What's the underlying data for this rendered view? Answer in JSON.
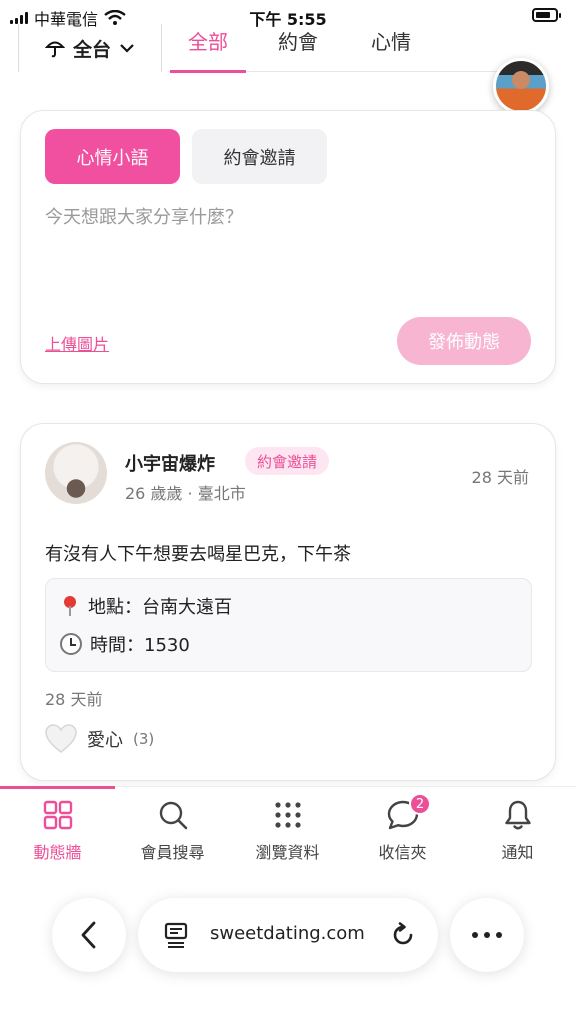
{
  "status_bar": {
    "carrier": "中華電信",
    "time": "下午 5:55"
  },
  "top_nav": {
    "region_label": "全台",
    "tabs": [
      {
        "label": "全部",
        "active": true
      },
      {
        "label": "約會",
        "active": false
      },
      {
        "label": "心情",
        "active": false
      }
    ]
  },
  "compose": {
    "tab_mood": "心情小語",
    "tab_date": "約會邀請",
    "placeholder": "今天想跟大家分享什麼？",
    "upload_label": "上傳圖片",
    "publish_label": "發佈動態"
  },
  "post": {
    "author": "小宇宙爆炸",
    "badge": "約會邀請",
    "meta": "26 歲歲 · 臺北市",
    "time": "28 天前",
    "content": "有沒有人下午想要去喝星巴克，下午茶",
    "location": "地點：台南大遠百",
    "datetime": "時間：1530",
    "footer_time": "28 天前",
    "like_label": "愛心",
    "like_count": "(3)"
  },
  "tabbar": {
    "items": [
      {
        "label": "動態牆",
        "icon": "grid-icon",
        "active": true
      },
      {
        "label": "會員搜尋",
        "icon": "search-icon",
        "active": false
      },
      {
        "label": "瀏覽資料",
        "icon": "dots-grid-icon",
        "active": false
      },
      {
        "label": "收信夾",
        "icon": "chat-bubble-icon",
        "active": false,
        "badge": "2"
      },
      {
        "label": "通知",
        "icon": "bell-icon",
        "active": false
      }
    ]
  },
  "browser": {
    "url": "sweetdating.com"
  },
  "colors": {
    "accent": "#ec4e98",
    "accent_light": "#f7b5d2",
    "badge_bg": "#fde6f1"
  }
}
